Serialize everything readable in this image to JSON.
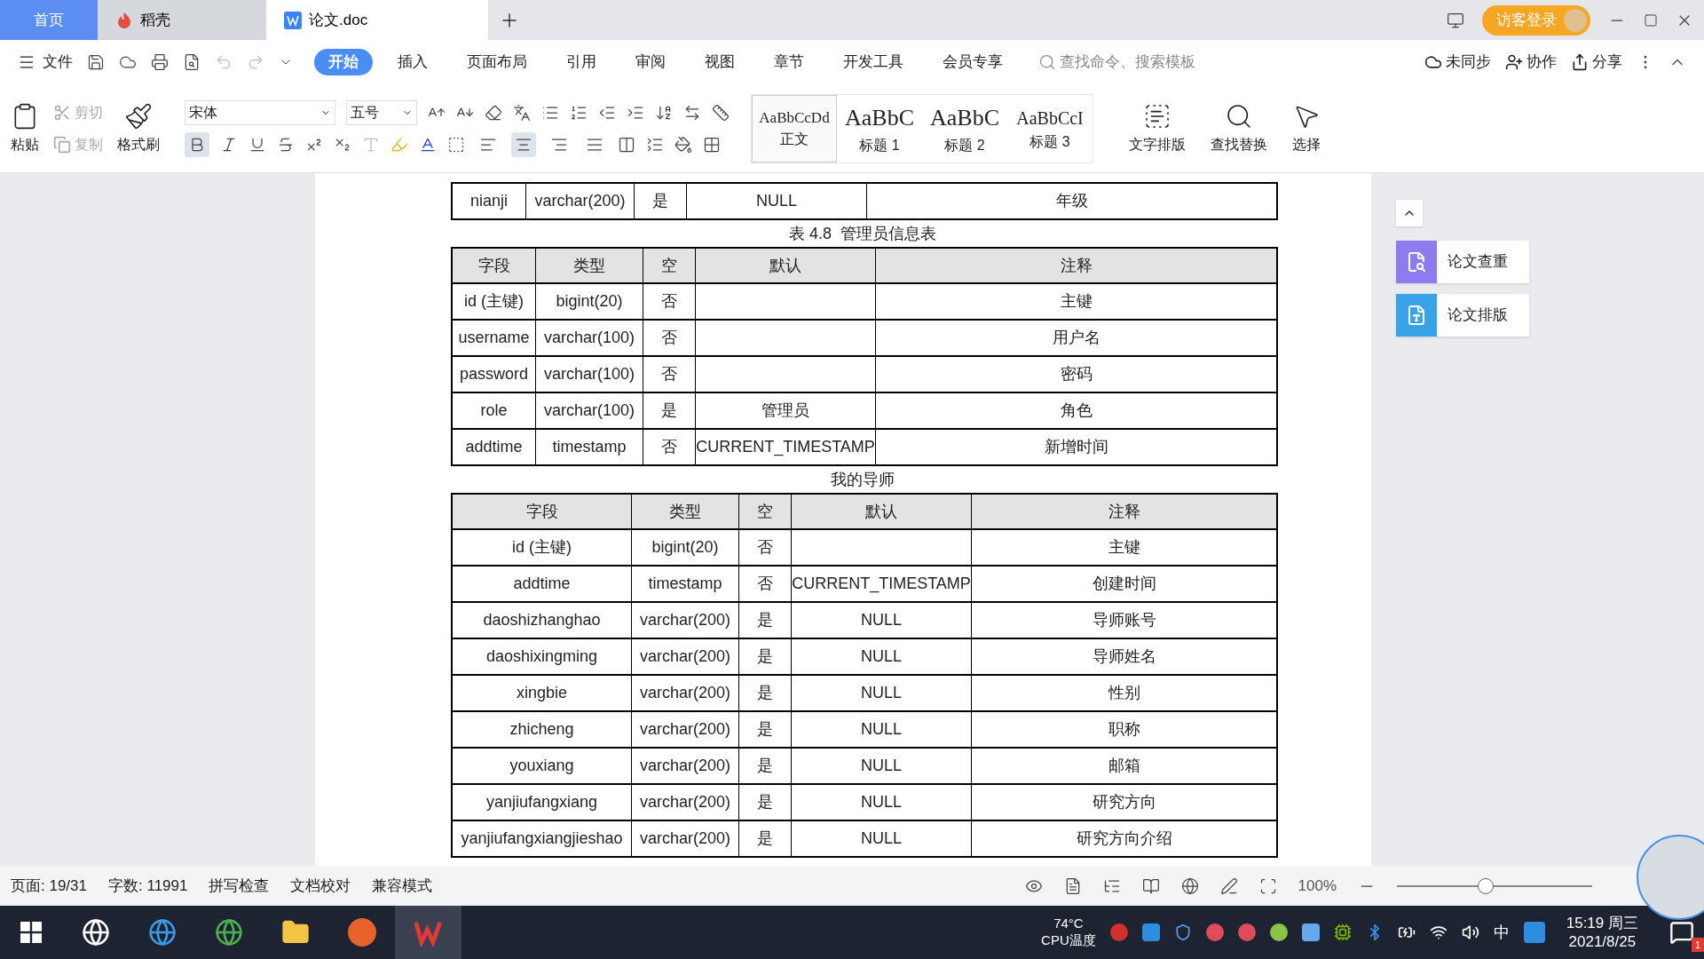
{
  "title_tabs": [
    {
      "kind": "home",
      "label": "首页",
      "selected": false
    },
    {
      "kind": "app",
      "label": "稻壳",
      "selected": false
    },
    {
      "kind": "doc",
      "label": "论文.doc",
      "selected": true
    }
  ],
  "account": {
    "label": "访客登录"
  },
  "menu": {
    "file": "文件",
    "tabs": [
      {
        "label": "开始",
        "selected": true
      },
      {
        "label": "插入",
        "selected": false
      },
      {
        "label": "页面布局",
        "selected": false
      },
      {
        "label": "引用",
        "selected": false
      },
      {
        "label": "审阅",
        "selected": false
      },
      {
        "label": "视图",
        "selected": false
      },
      {
        "label": "章节",
        "selected": false
      },
      {
        "label": "开发工具",
        "selected": false
      },
      {
        "label": "会员专享",
        "selected": false
      }
    ],
    "search": {
      "placeholder": "查找命令、搜索模板"
    },
    "actions": [
      "未同步",
      "协作",
      "分享"
    ]
  },
  "ribbon": {
    "paste": "粘贴",
    "cut": "剪切",
    "copy": "复制",
    "format_painter": "格式刷",
    "font": "宋体",
    "size": "五号",
    "format": {
      "bold": true
    },
    "alignments": [
      {
        "kind": "left",
        "selected": false
      },
      {
        "kind": "center",
        "selected": true
      },
      {
        "kind": "right",
        "selected": false
      },
      {
        "kind": "justify",
        "selected": false
      }
    ],
    "styles": [
      {
        "sample": "AaBbCcDd",
        "label": "正文",
        "selected": true
      },
      {
        "sample": "AaBbC",
        "label": "标题 1",
        "selected": false
      },
      {
        "sample": "AaBbC",
        "label": "标题 2",
        "selected": false
      },
      {
        "sample": "AaBbCcI",
        "label": "标题 3",
        "selected": false
      }
    ],
    "tools": [
      "文字排版",
      "查找替换",
      "选择"
    ]
  },
  "document": {
    "tables": [
      {
        "rows": [
          [
            "nianji",
            "varchar(200)",
            "是",
            "NULL",
            "年级"
          ]
        ]
      },
      {
        "caption": "表 4.8  管理员信息表",
        "columns": [
          "字段",
          "类型",
          "空",
          "默认",
          "注释"
        ],
        "rows": [
          [
            "id (主键)",
            "bigint(20)",
            "否",
            "",
            "主键"
          ],
          [
            "username",
            "varchar(100)",
            "否",
            "",
            "用户名"
          ],
          [
            "password",
            "varchar(100)",
            "否",
            "",
            "密码"
          ],
          [
            "role",
            "varchar(100)",
            "是",
            "管理员",
            "角色"
          ],
          [
            "addtime",
            "timestamp",
            "否",
            "CURRENT_TIMESTAMP",
            "新增时间"
          ]
        ]
      },
      {
        "caption": "我的导师",
        "columns": [
          "字段",
          "类型",
          "空",
          "默认",
          "注释"
        ],
        "rows": [
          [
            "id (主键)",
            "bigint(20)",
            "否",
            "",
            "主键"
          ],
          [
            "addtime",
            "timestamp",
            "否",
            "CURRENT_TIMESTAMP",
            "创建时间"
          ],
          [
            "daoshizhanghao",
            "varchar(200)",
            "是",
            "NULL",
            "导师账号"
          ],
          [
            "daoshixingming",
            "varchar(200)",
            "是",
            "NULL",
            "导师姓名"
          ],
          [
            "xingbie",
            "varchar(200)",
            "是",
            "NULL",
            "性别"
          ],
          [
            "zhicheng",
            "varchar(200)",
            "是",
            "NULL",
            "职称"
          ],
          [
            "youxiang",
            "varchar(200)",
            "是",
            "NULL",
            "邮箱"
          ],
          [
            "yanjiufangxiang",
            "varchar(200)",
            "是",
            "NULL",
            "研究方向"
          ],
          [
            "yanjiufangxiangjieshao",
            "varchar(200)",
            "是",
            "NULL",
            "研究方向介绍"
          ]
        ]
      }
    ]
  },
  "side_panel": [
    {
      "kind": "check",
      "label": "论文查重"
    },
    {
      "kind": "layout",
      "label": "论文排版"
    }
  ],
  "status_bar": {
    "page": "页面: 19/31",
    "words": "字数: 11991",
    "spell": "拼写检查",
    "proof": "文档校对",
    "mode": "兼容模式",
    "zoom": "100%",
    "zoom_slider": {
      "level": 0.45
    }
  },
  "taskbar": {
    "temp": "74°C",
    "temp_label": "CPU温度",
    "ime": "中",
    "time": "15:19 周三",
    "date": "2021/8/25",
    "badge": "1"
  }
}
